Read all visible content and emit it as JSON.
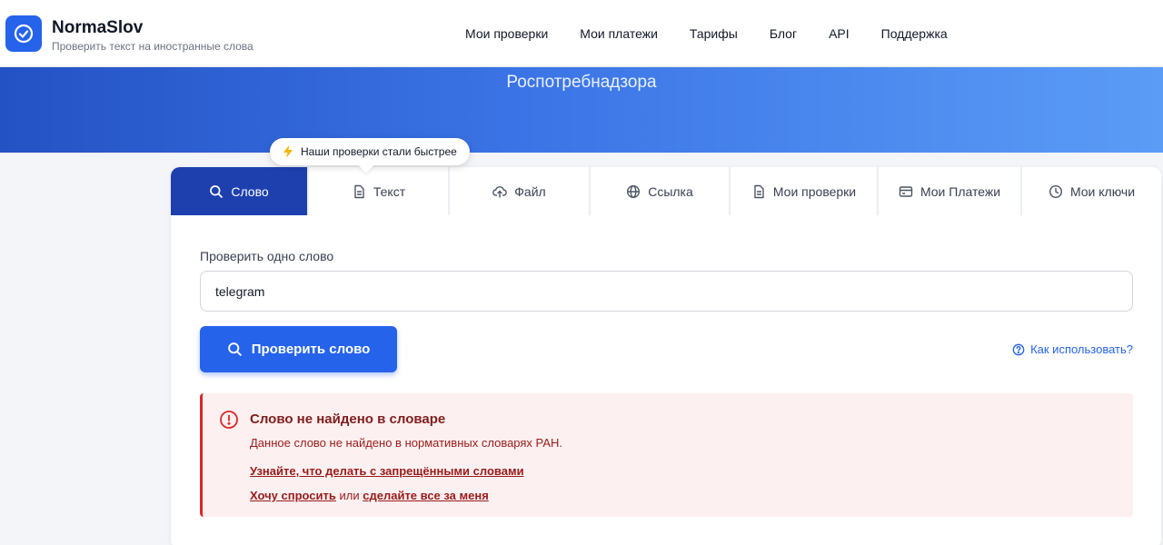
{
  "header": {
    "brand_name": "NormaSlov",
    "brand_subtitle": "Проверить текст на иностранные слова",
    "nav": [
      "Мои проверки",
      "Мои платежи",
      "Тарифы",
      "Блог",
      "API",
      "Поддержка"
    ]
  },
  "hero": {
    "line_partial": "",
    "line": "Роспотребнадзора"
  },
  "tooltip": {
    "text": "Наши проверки стали быстрее"
  },
  "tabs": [
    {
      "label": "Слово",
      "icon": "search-icon",
      "active": true
    },
    {
      "label": "Текст",
      "icon": "document-icon",
      "active": false
    },
    {
      "label": "Файл",
      "icon": "upload-cloud-icon",
      "active": false
    },
    {
      "label": "Ссылка",
      "icon": "globe-icon",
      "active": false
    },
    {
      "label": "Мои проверки",
      "icon": "document-icon",
      "active": false
    },
    {
      "label": "Мои Платежи",
      "icon": "credit-card-icon",
      "active": false
    },
    {
      "label": "Мои ключи",
      "icon": "clock-icon",
      "active": false
    }
  ],
  "form": {
    "label": "Проверить одно слово",
    "input_value": "telegram",
    "button_label": "Проверить слово",
    "help_link": "Как использовать?"
  },
  "alert": {
    "title": "Слово не найдено в словаре",
    "description": "Данное слово не найдено в нормативных словарях РАН.",
    "link_forbidden": "Узнайте, что делать с запрещёнными словами",
    "link_ask": "Хочу спросить",
    "or_text": "или",
    "link_do_for_me": "сделайте все за меня"
  },
  "colors": {
    "primary": "#2563eb",
    "active_tab": "#1e40af",
    "error": "#dc2626",
    "error_bg": "#fdf0f0"
  }
}
